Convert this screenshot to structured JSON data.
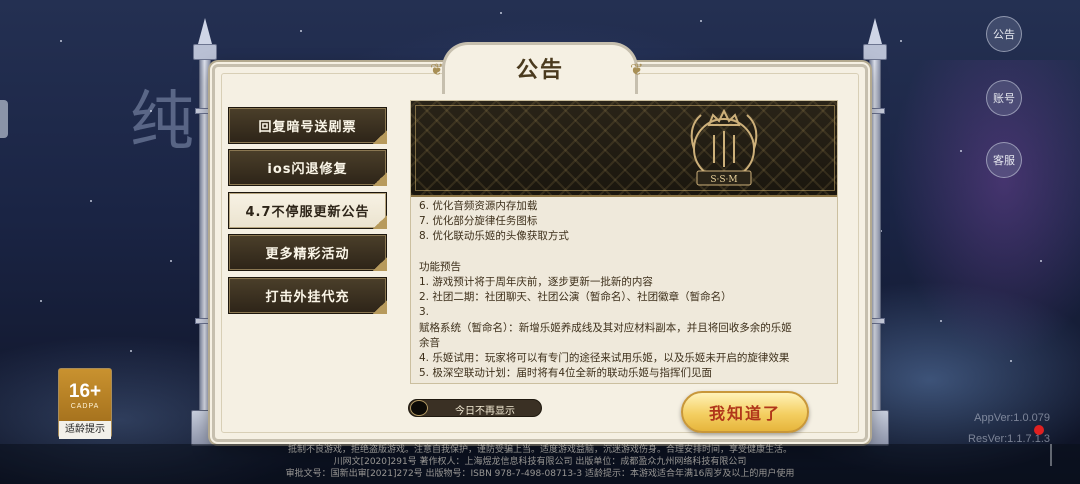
{
  "header": {
    "title": "公告"
  },
  "nav": {
    "items": [
      {
        "label": "回复暗号送剧票",
        "active": false
      },
      {
        "label": "ios闪退修复",
        "active": false
      },
      {
        "label": "4.7不停服更新公告",
        "active": true
      },
      {
        "label": "更多精彩活动",
        "active": false
      },
      {
        "label": "打击外挂代充",
        "active": false
      }
    ]
  },
  "content": {
    "banner_text": "S·S·M",
    "lines": [
      "6. 优化音频资源内存加载",
      "7. 优化部分旋律任务图标",
      "8. 优化联动乐姬的头像获取方式",
      "",
      "功能预告",
      "1. 游戏预计将于周年庆前，逐步更新一批新的内容",
      "2. 社团二期：社团聊天、社团公演（暂命名）、社团徽章（暂命名）",
      "3.",
      "赋格系统（暂命名）：新增乐姬养成线及其对应材料副本，并且将回收多余的乐姬",
      "余音",
      "4. 乐姬试用：玩家将可以有专门的途径来试用乐姬，以及乐姬未开启的旋律效果",
      "5. 极深空联动计划：届时将有4位全新的联动乐姬与指挥们见面"
    ]
  },
  "controls": {
    "dont_show_today": "今日不再显示",
    "confirm_button": "我知道了"
  },
  "side_buttons": {
    "notice": "公告",
    "account": "账号",
    "service": "客服"
  },
  "version": {
    "app": "AppVer:1.0.079",
    "res": "ResVer:1.1.7.1.3"
  },
  "age_rating": {
    "number": "16+",
    "org": "CADPA",
    "tip": "适龄提示"
  },
  "background": {
    "title_glyph": "纯"
  },
  "footer": {
    "line1": "抵制不良游戏，拒绝盗版游戏。注意自我保护，谨防受骗上当。适度游戏益脑，沉迷游戏伤身。合理安排时间，享受健康生活。",
    "line2": "川网文[2020]291号   著作权人：上海煜龙信息科技有限公司   出版单位：成都盈众九州网络科技有限公司",
    "line3": "审批文号：国新出审[2021]272号   出版物号：ISBN 978-7-498-08713-3   适龄提示：本游戏适合年满16周岁及以上的用户使用"
  },
  "colors": {
    "accent_gold": "#f4cf62",
    "confirm_text": "#b0361a",
    "panel_bg": "#f5f0e3",
    "nav_dark": "#3a3024"
  },
  "icons": [
    "scroll-ornament-icon",
    "emblem-crest-icon",
    "toggle-knob-icon"
  ]
}
